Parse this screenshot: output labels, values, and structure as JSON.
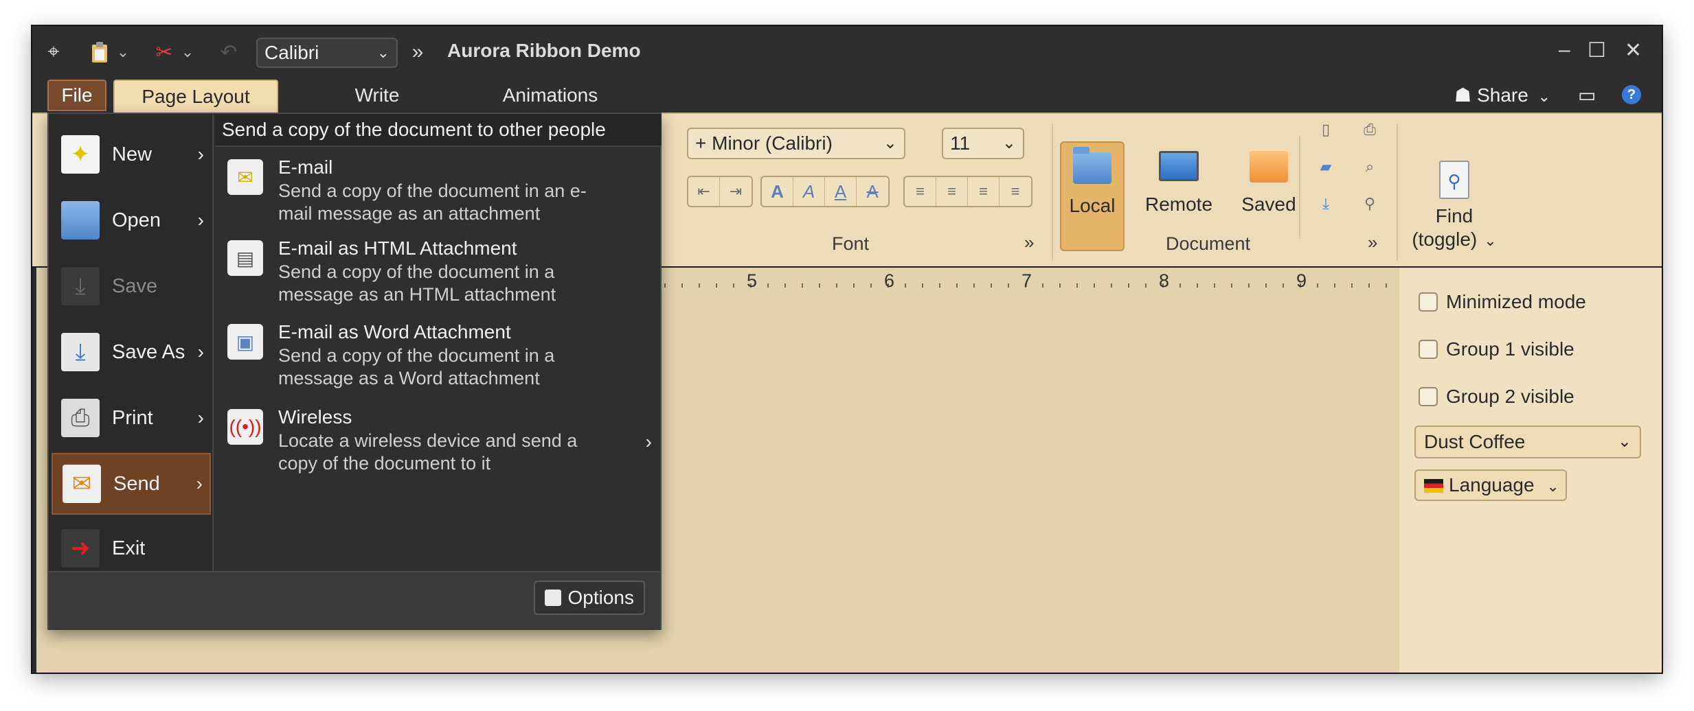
{
  "window": {
    "title": "Aurora Ribbon Demo"
  },
  "qat": {
    "font_name": "Calibri",
    "overflow": "»",
    "icons": [
      "app-menu-icon",
      "paste-icon",
      "cut-icon",
      "undo-icon"
    ]
  },
  "controls": {
    "minimize": "–",
    "maximize": "☐",
    "close": "✕"
  },
  "tabs": {
    "file": "File",
    "items": [
      {
        "label": "Page Layout",
        "active": true
      },
      {
        "label": "Write",
        "active": false
      },
      {
        "label": "Animations",
        "active": false
      }
    ],
    "share": "Share",
    "help": "?"
  },
  "ribbon": {
    "font_group": {
      "font_combo": "+ Minor (Calibri)",
      "size_combo": "11",
      "label": "Font",
      "launcher": "»"
    },
    "document_group": {
      "label": "Document",
      "launcher": "»",
      "buttons": [
        {
          "label": "Local",
          "active": true
        },
        {
          "label": "Remote",
          "active": false
        },
        {
          "label": "Saved",
          "active": false
        }
      ]
    },
    "find": {
      "line1": "Find",
      "line2": "(toggle)"
    }
  },
  "ruler": {
    "numbers": [
      "5",
      "6",
      "7",
      "8",
      "9"
    ]
  },
  "side_panel": {
    "checkboxes": [
      {
        "label": "Minimized mode",
        "checked": false
      },
      {
        "label": "Group 1 visible",
        "checked": false
      },
      {
        "label": "Group 2 visible",
        "checked": false
      }
    ],
    "skin": "Dust Coffee",
    "language": "Language"
  },
  "app_menu": {
    "primary": [
      {
        "label": "New",
        "has_sub": true,
        "disabled": false,
        "selected": false
      },
      {
        "label": "Open",
        "has_sub": true,
        "disabled": false,
        "selected": false
      },
      {
        "label": "Save",
        "has_sub": false,
        "disabled": true,
        "selected": false
      },
      {
        "label": "Save As",
        "has_sub": true,
        "disabled": false,
        "selected": false
      },
      {
        "label": "Print",
        "has_sub": true,
        "disabled": false,
        "selected": false
      },
      {
        "label": "Send",
        "has_sub": true,
        "disabled": false,
        "selected": true
      },
      {
        "label": "Exit",
        "has_sub": false,
        "disabled": false,
        "selected": false
      }
    ],
    "secondary_header": "Send a copy of the document to other people",
    "secondary": [
      {
        "title": "E-mail",
        "desc_1": "Send a copy of the document in an e-",
        "desc_2": "mail message as an attachment"
      },
      {
        "title": "E-mail as HTML Attachment",
        "desc_1": "Send a copy of the document in a",
        "desc_2": "message as an HTML attachment"
      },
      {
        "title": "E-mail as Word Attachment",
        "desc_1": "Send a copy of the document in a",
        "desc_2": "message as a Word attachment"
      },
      {
        "title": "Wireless",
        "desc_1": "Locate a wireless device and send a",
        "desc_2": "copy of the document to it"
      }
    ],
    "options": "Options"
  },
  "colors": {
    "titlebar": "#2e2e2e",
    "ribbon": "#ecdcb9",
    "document": "#e2d2ad",
    "selected_menu": "#6e4225",
    "file_tab": "#7a4a2e"
  }
}
